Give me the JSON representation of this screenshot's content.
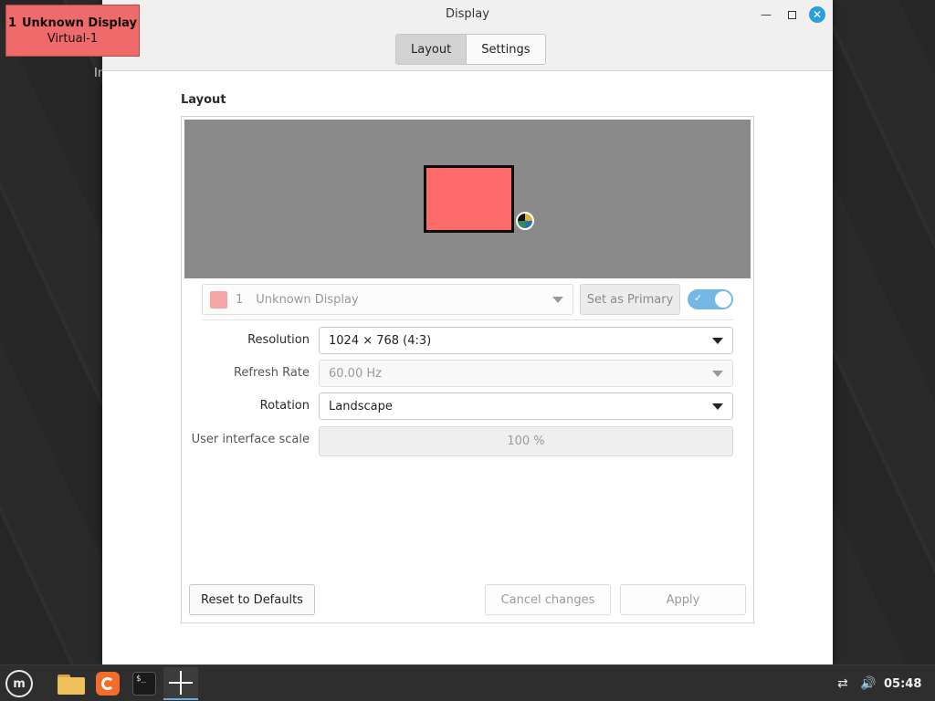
{
  "desktop": {
    "partial_text": "In"
  },
  "osd": {
    "number": "1",
    "name": "Unknown Display",
    "output": "Virtual-1"
  },
  "window": {
    "title": "Display",
    "tabs": [
      {
        "label": "Layout",
        "active": true
      },
      {
        "label": "Settings",
        "active": false
      }
    ],
    "section_label": "Layout",
    "display_selector": {
      "number": "1",
      "name": "Unknown Display",
      "swatch_color": "#f4a6a6"
    },
    "set_primary_label": "Set as Primary",
    "enabled_toggle": true,
    "properties": {
      "resolution": {
        "label": "Resolution",
        "value": "1024 × 768 (4:3)"
      },
      "refresh_rate": {
        "label": "Refresh Rate",
        "value": "60.00 Hz"
      },
      "rotation": {
        "label": "Rotation",
        "value": "Landscape"
      },
      "ui_scale": {
        "label": "User interface scale",
        "value": "100 %"
      }
    },
    "buttons": {
      "reset": "Reset to Defaults",
      "cancel": "Cancel changes",
      "apply": "Apply"
    }
  },
  "taskbar": {
    "apps": [
      "menu-icon",
      "files-icon",
      "firefox-icon",
      "terminal-icon",
      "display-settings-icon"
    ],
    "clock": "05:48"
  },
  "colors": {
    "monitor": "#fd6a6a",
    "preview_bg": "#8a8a8a",
    "accent": "#2b9fd9",
    "toggle": "#74b9e6"
  }
}
